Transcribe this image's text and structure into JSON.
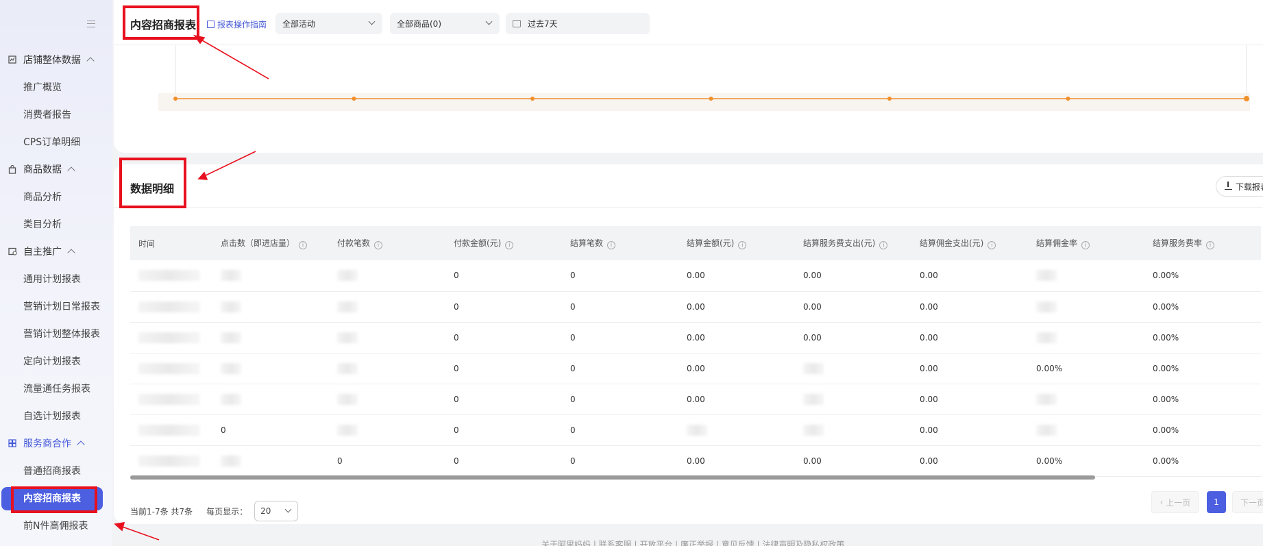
{
  "sidebar": {
    "groups": [
      {
        "label": "店铺整体数据",
        "icon": "chart-icon",
        "items": [
          "推广概览",
          "消费者报告",
          "CPS订单明细"
        ]
      },
      {
        "label": "商品数据",
        "icon": "bag-icon",
        "items": [
          "商品分析",
          "类目分析"
        ]
      },
      {
        "label": "自主推广",
        "icon": "promotion-icon",
        "items": [
          "通用计划报表",
          "营销计划日常报表",
          "营销计划整体报表",
          "定向计划报表",
          "流量通任务报表",
          "自选计划报表"
        ]
      },
      {
        "label": "服务商合作",
        "icon": "partner-icon",
        "items": [
          "普通招商报表",
          "内容招商报表",
          "前N件高佣报表"
        ]
      }
    ],
    "active_item": "内容招商报表"
  },
  "toolbar": {
    "title": "内容招商报表",
    "guide_link": "报表操作指南",
    "activity_select": "全部活动",
    "product_select": "全部商品(0)",
    "date_range": "过去7天"
  },
  "chart_data": {
    "type": "line",
    "series": [
      {
        "values": [
          0,
          0,
          0,
          0,
          0,
          0,
          0
        ],
        "color": "#f0902a"
      }
    ],
    "note_hidden_labels": true
  },
  "detail": {
    "title": "数据明细",
    "download_button": "下载报表",
    "columns": [
      "时间",
      "点击数（即进店量）",
      "付款笔数",
      "付款金额(元)",
      "结算笔数",
      "结算金额(元)",
      "结算服务费支出(元)",
      "结算佣金支出(元)",
      "结算佣金率",
      "结算服务费率"
    ],
    "rows": [
      [
        "",
        "",
        "",
        "0",
        "0",
        "0.00",
        "0.00",
        "0.00",
        "",
        "0.00%"
      ],
      [
        "",
        "",
        "",
        "0",
        "0",
        "0.00",
        "0.00",
        "0.00",
        "",
        "0.00%"
      ],
      [
        "",
        "",
        "",
        "0",
        "0",
        "0.00",
        "0.00",
        "0.00",
        "",
        "0.00%"
      ],
      [
        "",
        "",
        "",
        "0",
        "0",
        "0.00",
        "",
        "0.00",
        "0.00%",
        "0.00%"
      ],
      [
        "",
        "",
        "",
        "0",
        "0",
        "0.00",
        "",
        "0.00",
        "",
        "0.00%"
      ],
      [
        "",
        "0",
        "",
        "0",
        "0",
        "",
        "",
        "0.00",
        "",
        "0.00%"
      ],
      [
        "",
        "",
        "0",
        "0",
        "0",
        "0.00",
        "0.00",
        "0.00",
        "0.00%",
        "0.00%"
      ]
    ]
  },
  "pager": {
    "summary": "当前1-7条 共7条",
    "per_page_label": "每页显示：",
    "per_page_value": "20",
    "prev": "上一页",
    "page": "1",
    "next": "下一页"
  },
  "footer": "关于阿里妈妈 | 联系客服 | 开放平台 | 廉正举报 | 意见反馈 | 法律声明及隐私权政策",
  "colors": {
    "accent": "#4c5fe0",
    "annotation": "#e8101e",
    "chart_line": "#f0902a"
  }
}
